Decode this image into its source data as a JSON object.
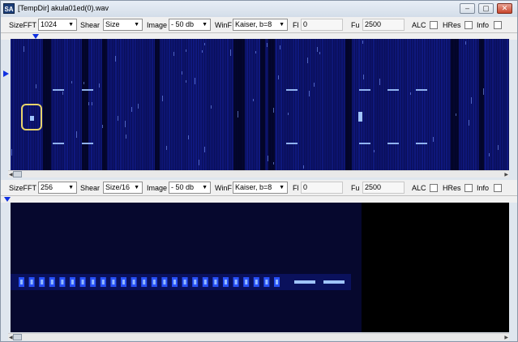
{
  "window": {
    "icon": "SA",
    "title": "[TempDir] akula01ed(0).wav",
    "minimize": "‒",
    "maximize": "▢",
    "close": "✕"
  },
  "panels": [
    {
      "sizefft_label": "SizeFFT",
      "sizefft_value": "1024",
      "shear_label": "Shear",
      "shear_value": "Size",
      "image_label": "Image",
      "image_value": "- 50 db",
      "winf_label": "WinF",
      "winf_value": "Kaiser, b=8",
      "fl_label": "Fl",
      "fl_value": "0",
      "fu_label": "Fu",
      "fu_value": "2500",
      "alc_label": "ALC",
      "hres_label": "HRes",
      "info_label": "Info",
      "alc_checked": false,
      "hres_checked": false,
      "info_checked": false
    },
    {
      "sizefft_label": "SizeFFT",
      "sizefft_value": "256",
      "shear_label": "Shear",
      "shear_value": "Size/16",
      "image_label": "Image",
      "image_value": "- 50 db",
      "winf_label": "WinF",
      "winf_value": "Kaiser, b=8",
      "fl_label": "Fl",
      "fl_value": "0",
      "fu_label": "Fu",
      "fu_value": "2500",
      "alc_label": "ALC",
      "hres_label": "HRes",
      "info_label": "Info",
      "alc_checked": false,
      "hres_checked": false,
      "info_checked": false
    }
  ],
  "colors": {
    "spectrogram_bg": "#06082e",
    "signal": "#2a55ff",
    "signal_peak": "#9fc4ff",
    "marker": "#1030e0",
    "highlight": "#e8d46a"
  },
  "icons": {
    "dropdown": "chevron-down-icon",
    "scroll_left": "scroll-left-icon",
    "scroll_right": "scroll-right-icon",
    "marker": "triangle-marker-icon"
  }
}
